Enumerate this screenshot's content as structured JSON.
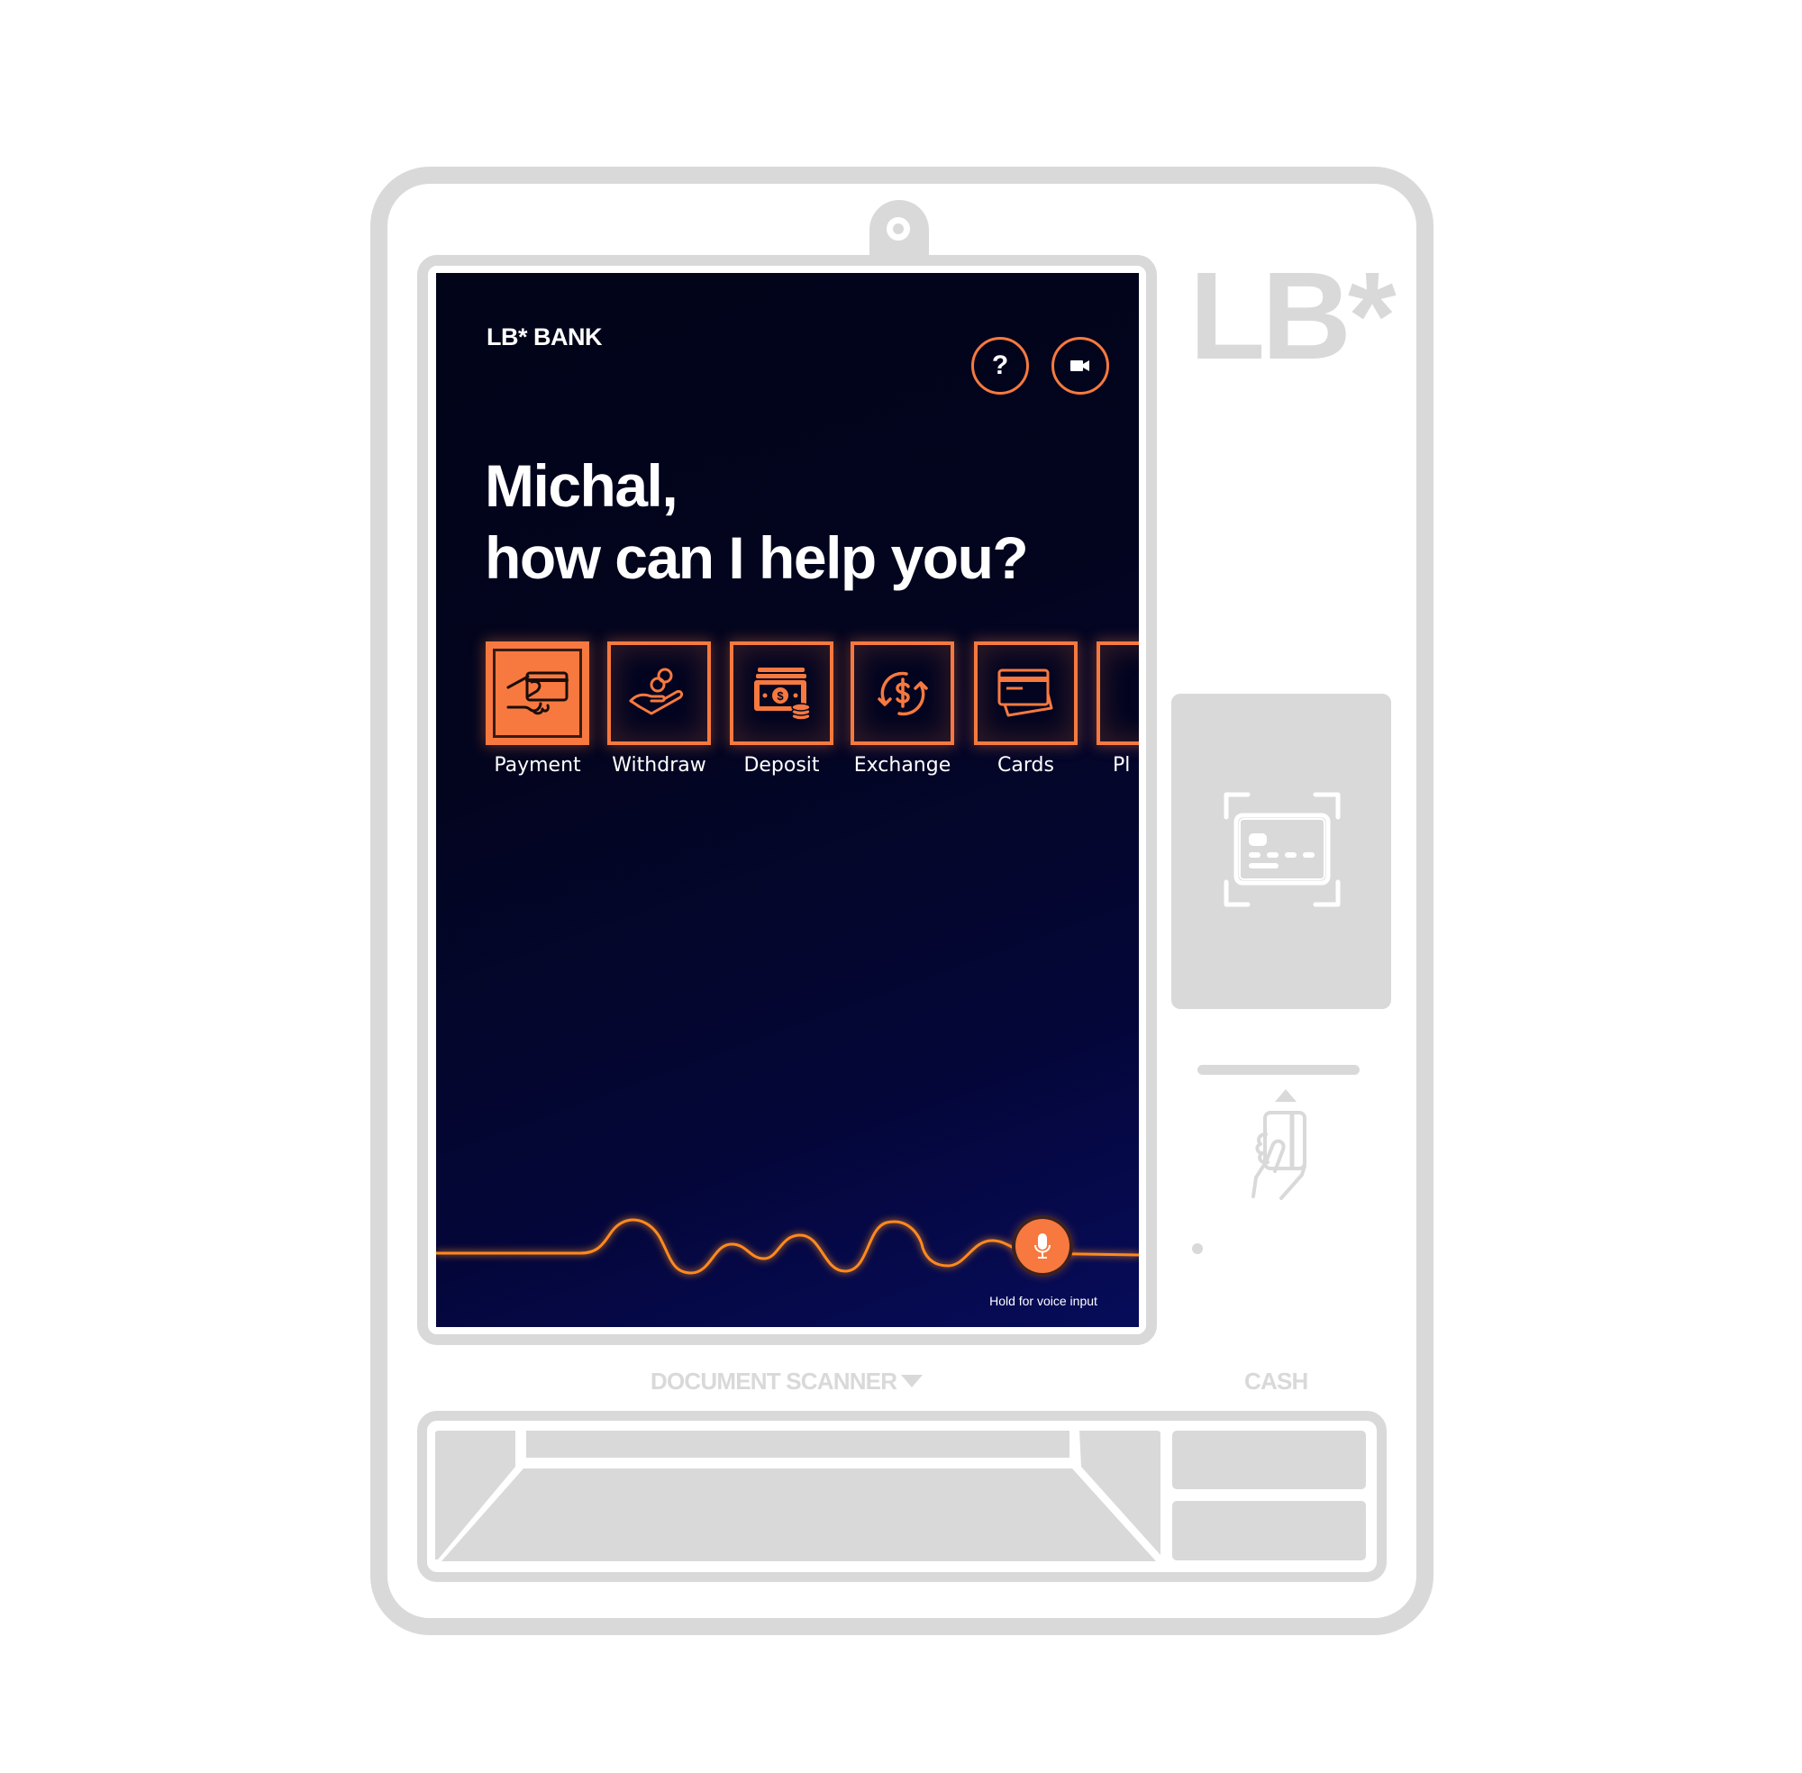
{
  "kiosk": {
    "logo": "LB*",
    "document_scanner_label": "DOCUMENT SCANNER",
    "cash_label": "CASH",
    "colors": {
      "hardware_gray": "#d9d9d9",
      "accent_orange": "#f7793f",
      "screen_bg_dark": "#020419",
      "screen_bg_blue": "#070c5a"
    }
  },
  "screen": {
    "brand": "LB* BANK",
    "help_button": {
      "label": "?",
      "icon": "question-icon"
    },
    "video_button": {
      "icon": "video-camera-icon"
    },
    "greeting_line1": "Michal,",
    "greeting_line2": "how can I help you?",
    "services": [
      {
        "label": "Payment",
        "icon": "card-in-hand-icon",
        "selected": true
      },
      {
        "label": "Withdraw",
        "icon": "coins-hand-icon",
        "selected": false
      },
      {
        "label": "Deposit",
        "icon": "cash-stack-icon",
        "selected": false
      },
      {
        "label": "Exchange",
        "icon": "currency-exchange-icon",
        "selected": false
      },
      {
        "label": "Cards",
        "icon": "cards-icon",
        "selected": false
      },
      {
        "label": "Pl",
        "icon": "unknown-icon",
        "selected": false
      }
    ],
    "voice": {
      "hint": "Hold for voice input",
      "icon": "microphone-icon"
    }
  }
}
